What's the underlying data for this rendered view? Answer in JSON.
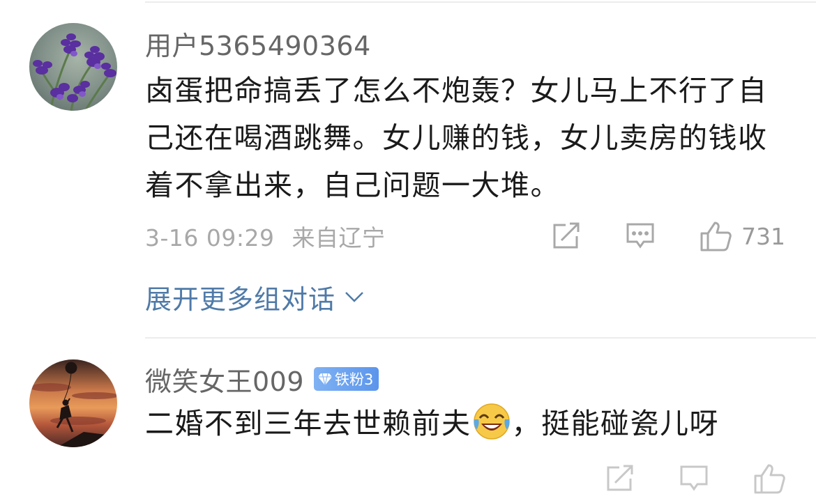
{
  "comments": [
    {
      "username": "用户5365490364",
      "content": "卤蛋把命搞丢了怎么不炮轰？女儿马上不行了自己还在喝酒跳舞。女儿赚的钱，女儿卖房的钱收着不拿出来，自己问题一大堆。",
      "time": "3-16 09:29",
      "location": "来自辽宁",
      "likes": "731",
      "expand_label": "展开更多组对话",
      "avatar": "lavender-flowers"
    },
    {
      "username": "微笑女王009",
      "badge": "铁粉3",
      "content_before": "二婚不到三年去世赖前夫",
      "content_emoji": "laugh-cry-emoji",
      "content_after": "，挺能碰瓷儿呀",
      "avatar": "girl-with-balloon-sunset"
    }
  ],
  "colors": {
    "username": "#666666",
    "meta": "#a8a8a8",
    "link": "#4f7aa8",
    "badge": "#6fa2ef"
  }
}
